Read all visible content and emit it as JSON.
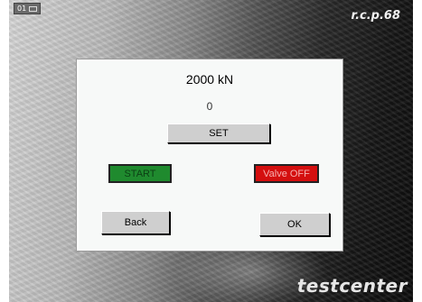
{
  "header": {
    "screen_id": "01",
    "screen_icon": "keyboard-icon",
    "code": "r.c.p.68"
  },
  "dialog": {
    "title": "2000 kN",
    "value": "0",
    "set_label": "SET",
    "start_label": "START",
    "valve_label": "Valve OFF",
    "back_label": "Back",
    "ok_label": "OK"
  },
  "footer": {
    "brand": "testcenter"
  },
  "colors": {
    "start": "#1f8a2e",
    "valve": "#d40f0f",
    "dialog_bg": "#f7f9f8"
  }
}
